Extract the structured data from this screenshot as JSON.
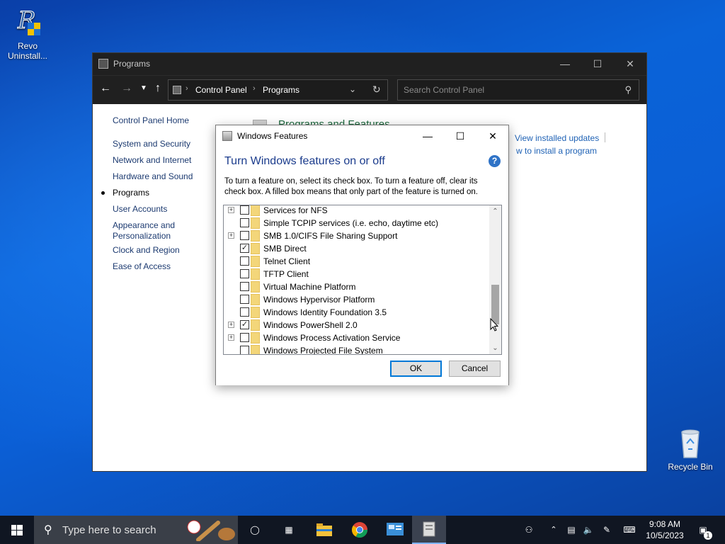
{
  "desktop": {
    "icons": [
      {
        "label": "Revo Uninstall..."
      },
      {
        "label": "Recycle Bin"
      }
    ]
  },
  "window": {
    "title": "Programs",
    "breadcrumb": [
      "Control Panel",
      "Programs"
    ],
    "search_placeholder": "Search Control Panel",
    "sidebar": {
      "home": "Control Panel Home",
      "items": [
        "System and Security",
        "Network and Internet",
        "Hardware and Sound",
        "Programs",
        "User Accounts",
        "Appearance and Personalization",
        "Clock and Region",
        "Ease of Access"
      ],
      "active": "Programs"
    },
    "main": {
      "heading": "Programs and Features",
      "link_updates": "View installed updates",
      "link_install": "w to install a program"
    }
  },
  "dialog": {
    "title": "Windows Features",
    "heading": "Turn Windows features on or off",
    "help_label": "?",
    "description": "To turn a feature on, select its check box. To turn a feature off, clear its check box. A filled box means that only part of the feature is turned on.",
    "features": [
      {
        "label": "Services for NFS",
        "expandable": true,
        "checked": false
      },
      {
        "label": "Simple TCPIP services (i.e. echo, daytime etc)",
        "expandable": false,
        "checked": false
      },
      {
        "label": "SMB 1.0/CIFS File Sharing Support",
        "expandable": true,
        "checked": false
      },
      {
        "label": "SMB Direct",
        "expandable": false,
        "checked": true
      },
      {
        "label": "Telnet Client",
        "expandable": false,
        "checked": false
      },
      {
        "label": "TFTP Client",
        "expandable": false,
        "checked": false
      },
      {
        "label": "Virtual Machine Platform",
        "expandable": false,
        "checked": false
      },
      {
        "label": "Windows Hypervisor Platform",
        "expandable": false,
        "checked": false
      },
      {
        "label": "Windows Identity Foundation 3.5",
        "expandable": false,
        "checked": false
      },
      {
        "label": "Windows PowerShell 2.0",
        "expandable": true,
        "checked": true
      },
      {
        "label": "Windows Process Activation Service",
        "expandable": true,
        "checked": false
      },
      {
        "label": "Windows Projected File System",
        "expandable": false,
        "checked": false
      }
    ],
    "ok_label": "OK",
    "cancel_label": "Cancel"
  },
  "taskbar": {
    "search_placeholder": "Type here to search",
    "time": "9:08 AM",
    "date": "10/5/2023",
    "notification_count": "1"
  }
}
